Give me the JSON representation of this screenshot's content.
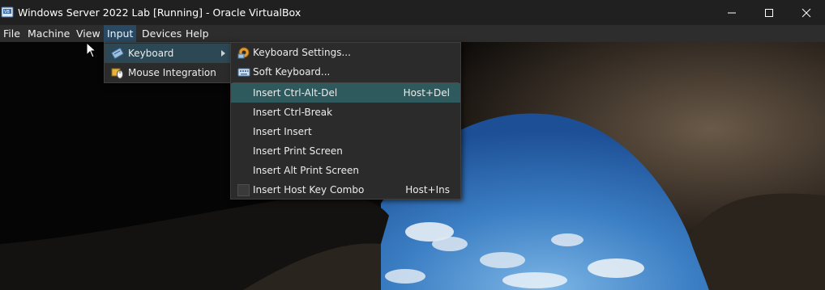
{
  "window": {
    "title": "Windows Server 2022 Lab [Running] - Oracle VirtualBox",
    "icon": "virtualbox-icon",
    "controls": [
      "minimize-icon",
      "maximize-icon",
      "close-icon"
    ]
  },
  "menubar": {
    "items": [
      {
        "label": "File"
      },
      {
        "label": "Machine"
      },
      {
        "label": "View"
      },
      {
        "label": "Input"
      },
      {
        "label": "Devices"
      },
      {
        "label": "Help"
      }
    ],
    "active": "Input"
  },
  "input_menu": {
    "items": [
      {
        "label": "Keyboard",
        "icon": "keyboard-icon",
        "has_submenu": true
      },
      {
        "label": "Mouse Integration",
        "icon": "mouse-integration-icon"
      }
    ]
  },
  "keyboard_submenu": {
    "items": [
      {
        "label": "Keyboard Settings...",
        "icon": "keyboard-settings-icon"
      },
      {
        "label": "Soft Keyboard...",
        "icon": "soft-keyboard-icon"
      },
      {
        "label": "Insert Ctrl-Alt-Del",
        "shortcut": "Host+Del",
        "highlighted": true
      },
      {
        "label": "Insert Ctrl-Break"
      },
      {
        "label": "Insert Insert"
      },
      {
        "label": "Insert Print Screen"
      },
      {
        "label": "Insert Alt Print Screen"
      },
      {
        "label": "Insert Host Key Combo",
        "shortcut": "Host+Ins",
        "checkbox": true
      }
    ]
  },
  "colors": {
    "titlebar_bg": "#202020",
    "menubar_bg": "#2d2d2d",
    "menu_bg": "#2b2b2b",
    "menu_highlight": "#2e5a5e",
    "sky": "#2f6fb8"
  }
}
